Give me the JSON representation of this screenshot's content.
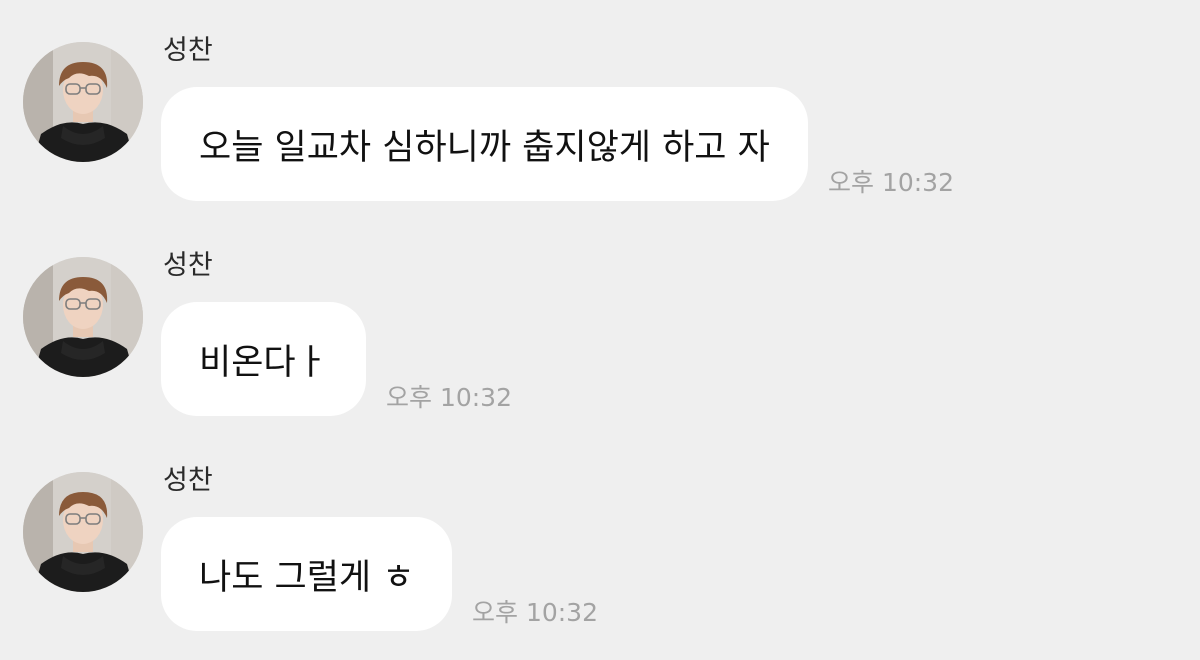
{
  "messages": [
    {
      "sender": "성찬",
      "text": "오늘 일교차 심하니까 춥지않게 하고 자",
      "time": "오후 10:32"
    },
    {
      "sender": "성찬",
      "text": "비온다ㅏ",
      "time": "오후 10:32"
    },
    {
      "sender": "성찬",
      "text": "나도 그럴게 ㅎ",
      "time": "오후 10:32"
    }
  ],
  "colors": {
    "background": "#efefef",
    "bubble": "#ffffff",
    "text": "#111111",
    "time": "#a3a3a3"
  }
}
